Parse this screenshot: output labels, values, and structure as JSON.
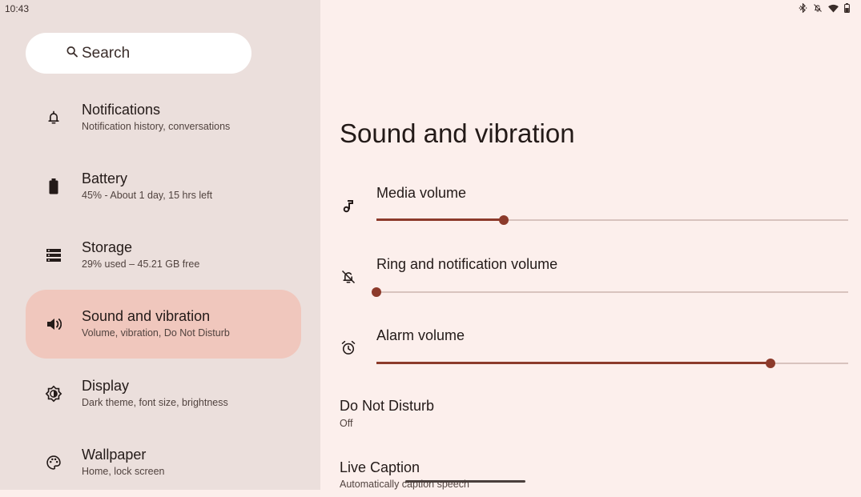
{
  "status_bar": {
    "time": "10:43",
    "icons": [
      "bluetooth-icon",
      "notifications-off-icon",
      "wifi-icon",
      "battery-icon"
    ]
  },
  "search": {
    "label": "Search",
    "icon": "search-icon"
  },
  "sidebar": {
    "items": [
      {
        "title": "Notifications",
        "subtitle": "Notification history, conversations",
        "icon": "bell-icon",
        "active": false
      },
      {
        "title": "Battery",
        "subtitle": "45% - About 1 day, 15 hrs left",
        "icon": "battery-icon",
        "active": false
      },
      {
        "title": "Storage",
        "subtitle": "29% used – 45.21 GB free",
        "icon": "storage-icon",
        "active": false
      },
      {
        "title": "Sound and vibration",
        "subtitle": "Volume, vibration, Do Not Disturb",
        "icon": "speaker-icon",
        "active": true
      },
      {
        "title": "Display",
        "subtitle": "Dark theme, font size, brightness",
        "icon": "display-icon",
        "active": false
      },
      {
        "title": "Wallpaper",
        "subtitle": "Home, lock screen",
        "icon": "palette-icon",
        "active": false
      }
    ]
  },
  "main": {
    "title": "Sound and vibration",
    "volumes": [
      {
        "label": "Media volume",
        "icon": "music-note-icon",
        "level": 0.27
      },
      {
        "label": "Ring and notification volume",
        "icon": "notifications-off-icon",
        "level": 0.0
      },
      {
        "label": "Alarm volume",
        "icon": "alarm-icon",
        "level": 0.835
      }
    ],
    "do_not_disturb": {
      "title": "Do Not Disturb",
      "subtitle": "Off"
    },
    "live_caption": {
      "title": "Live Caption",
      "subtitle": "Automatically caption speech"
    }
  },
  "colors": {
    "accent": "#8c3a2b",
    "active_bg": "#f0c7bd",
    "sidebar_bg": "#ebdfdc",
    "main_bg": "#fcefec"
  }
}
